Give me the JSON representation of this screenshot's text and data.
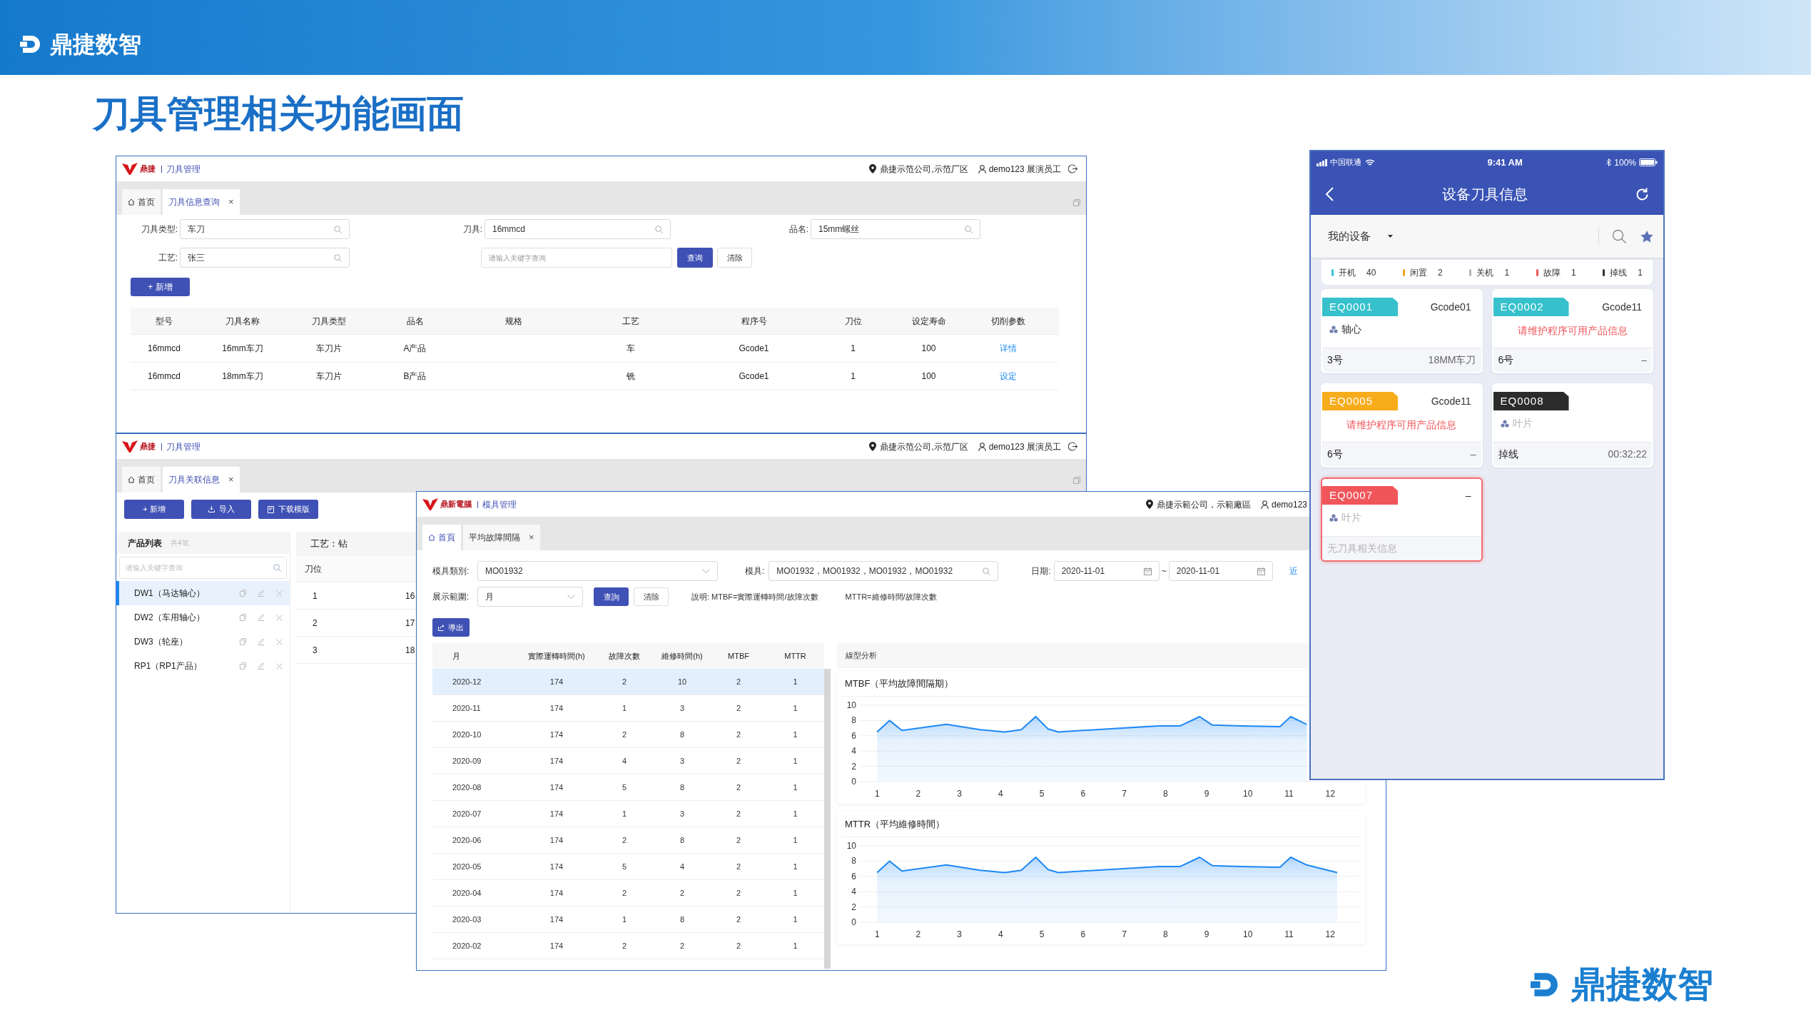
{
  "slide": {
    "brand": "鼎捷数智",
    "title": "刀具管理相关功能画面",
    "footer_brand": "鼎捷数智"
  },
  "tool_query_window": {
    "header": {
      "brand": "鼎捷",
      "module": "刀具管理",
      "location": "鼎捷示范公司,示范厂区",
      "user": "demo123 展演员工"
    },
    "tabs": [
      {
        "label": "首页",
        "selected": false
      },
      {
        "label": "刀具信息查询",
        "selected": true,
        "close": "×"
      }
    ],
    "filters": [
      {
        "label": "刀具类型:",
        "value": "车刀"
      },
      {
        "label": "刀具:",
        "value": "16mmcd"
      },
      {
        "label": "品名:",
        "value": "15mm螺丝"
      },
      {
        "label": "工艺:",
        "value": "张三"
      }
    ],
    "keyword": {
      "placeholder": "请输入关键字查询"
    },
    "query_button": "查询",
    "clear_button": "清除",
    "add_button": "+ 新增",
    "table": {
      "columns": [
        "型号",
        "刀具名称",
        "刀具类型",
        "品名",
        "规格",
        "工艺",
        "程序号",
        "刀位",
        "设定寿命",
        "切削参数"
      ],
      "rows": [
        {
          "cells": [
            "16mmcd",
            "16mm车刀",
            "车刀片",
            "A产品",
            "",
            "车",
            "Gcode1",
            "1",
            "100"
          ],
          "action": "详情"
        },
        {
          "cells": [
            "16mmcd",
            "18mm车刀",
            "车刀片",
            "B产品",
            "",
            "铣",
            "Gcode1",
            "1",
            "100"
          ],
          "action": "设定"
        }
      ]
    }
  },
  "association_window": {
    "header": {
      "brand": "鼎捷",
      "module": "刀具管理",
      "location": "鼎捷示范公司,示范厂区",
      "user": "demo123 展演员工"
    },
    "tabs": [
      {
        "label": "首页",
        "selected": false
      },
      {
        "label": "刀具关联信息",
        "selected": true,
        "close": "×"
      }
    ],
    "buttons": [
      {
        "kind": "add",
        "label": "+ 新增"
      },
      {
        "kind": "import",
        "label": "导入"
      },
      {
        "kind": "template",
        "label": "下载模版"
      }
    ],
    "product_list": {
      "title": "产品列表",
      "count": "共4笔",
      "search": {
        "placeholder": "请输入关键字查询"
      },
      "items": [
        {
          "label": "DW1（马达轴心）",
          "selected": true
        },
        {
          "label": "DW2（车用轴心）",
          "selected": false
        },
        {
          "label": "DW3（轮座）",
          "selected": false
        },
        {
          "label": "RP1（RP1产品）",
          "selected": false
        }
      ]
    },
    "process": {
      "title": "工艺：钻",
      "columns": [
        "刀位"
      ],
      "rows": [
        [
          "1",
          "16"
        ],
        [
          "2",
          "17"
        ],
        [
          "3",
          "18"
        ]
      ]
    }
  },
  "mold_window": {
    "header": {
      "brand": "鼎新電腦",
      "module": "模具管理",
      "location": "鼎捷示範公司，示範廠區",
      "user": "demo123"
    },
    "tabs": [
      {
        "label": "首頁",
        "selected": true
      },
      {
        "label": "平均故障間隔",
        "selected": false,
        "close": "×"
      }
    ],
    "category": {
      "label": "模具類別:",
      "value": "MO01932"
    },
    "mold": {
      "label": "模具:",
      "value": "MO01932，MO01932，MO01932，MO01932"
    },
    "date": {
      "label": "日期:",
      "from": "2020-11-01",
      "separator": "~",
      "to": "2020-11-01"
    },
    "recent_link": "近",
    "range": {
      "label": "展示範圍:",
      "value": "月"
    },
    "query_button": "查詢",
    "clear_button": "清除",
    "notes": [
      "說明: MTBF=實際運轉時間/故障次數",
      "MTTR=維修時間/故障次數"
    ],
    "export_button": "導出",
    "table": {
      "columns": [
        "月",
        "實際運轉時間(h)",
        "故障次數",
        "維修時間(h)",
        "MTBF",
        "MTTR"
      ],
      "rows": [
        {
          "cells": [
            "2020-12",
            "174",
            "2",
            "10",
            "2",
            "1"
          ],
          "selected": true
        },
        {
          "cells": [
            "2020-11",
            "174",
            "1",
            "3",
            "2",
            "1"
          ],
          "selected": false
        },
        {
          "cells": [
            "2020-10",
            "174",
            "2",
            "8",
            "2",
            "1"
          ],
          "selected": false
        },
        {
          "cells": [
            "2020-09",
            "174",
            "4",
            "3",
            "2",
            "1"
          ],
          "selected": false
        },
        {
          "cells": [
            "2020-08",
            "174",
            "5",
            "8",
            "2",
            "1"
          ],
          "selected": false
        },
        {
          "cells": [
            "2020-07",
            "174",
            "1",
            "3",
            "2",
            "1"
          ],
          "selected": false
        },
        {
          "cells": [
            "2020-06",
            "174",
            "2",
            "8",
            "2",
            "1"
          ],
          "selected": false
        },
        {
          "cells": [
            "2020-05",
            "174",
            "5",
            "4",
            "2",
            "1"
          ],
          "selected": false
        },
        {
          "cells": [
            "2020-04",
            "174",
            "2",
            "2",
            "2",
            "1"
          ],
          "selected": false
        },
        {
          "cells": [
            "2020-03",
            "174",
            "1",
            "8",
            "2",
            "1"
          ],
          "selected": false
        },
        {
          "cells": [
            "2020-02",
            "174",
            "2",
            "2",
            "2",
            "1"
          ],
          "selected": false
        }
      ]
    },
    "analysis": {
      "title": "線型分析",
      "charts": [
        {
          "chart_data": {
            "type": "area",
            "title": "MTBF（平均故障間隔期）",
            "x": [
              1.0,
              1.3,
              1.6,
              2.68,
              3.5,
              4.1,
              4.5,
              4.85,
              5.15,
              5.4,
              6.0,
              7.84,
              8.36,
              8.83,
              9.14,
              9.83,
              10.78,
              11.04,
              11.43
            ],
            "series": [
              {
                "color": "#1e88f5",
                "values": [
                  6.5,
                  8.0,
                  6.7,
                  7.5,
                  6.8,
                  6.5,
                  6.8,
                  8.5,
                  6.9,
                  6.5,
                  6.7,
                  7.3,
                  7.3,
                  8.5,
                  7.4,
                  7.3,
                  7.2,
                  8.5,
                  7.5
                ]
              }
            ],
            "xlim": [
              0.58,
              12.69
            ],
            "ylim": [
              0,
              10
            ],
            "xticks": [
              1,
              2,
              3,
              4,
              5,
              6,
              7,
              8,
              9,
              10,
              11,
              12
            ],
            "yticks": [
              0,
              2,
              4,
              6,
              8,
              10
            ],
            "grid": true
          }
        },
        {
          "chart_data": {
            "type": "area",
            "title": "MTTR（平均維修時間）",
            "x": [
              1.0,
              1.3,
              1.6,
              2.68,
              3.5,
              4.1,
              4.5,
              4.85,
              5.15,
              5.4,
              6.0,
              7.84,
              8.36,
              8.83,
              9.14,
              9.83,
              10.78,
              11.04,
              11.43,
              12.17
            ],
            "series": [
              {
                "color": "#1e88f5",
                "values": [
                  6.5,
                  8.0,
                  6.7,
                  7.5,
                  6.8,
                  6.5,
                  6.8,
                  8.5,
                  6.9,
                  6.5,
                  6.7,
                  7.3,
                  7.3,
                  8.5,
                  7.4,
                  7.3,
                  7.2,
                  8.5,
                  7.5,
                  6.5
                ]
              }
            ],
            "xlim": [
              0.58,
              12.69
            ],
            "ylim": [
              0,
              10
            ],
            "xticks": [
              1,
              2,
              3,
              4,
              5,
              6,
              7,
              8,
              9,
              10,
              11,
              12
            ],
            "yticks": [
              0,
              2,
              4,
              6,
              8,
              10
            ],
            "grid": true
          }
        }
      ]
    }
  },
  "mobile": {
    "status": {
      "carrier": "中国联通",
      "time": "9:41 AM",
      "battery": "100%"
    },
    "title": "设备刀具信息",
    "filter": "我的设备",
    "legend": [
      {
        "label": "开机",
        "count": "40",
        "color": "#3cc3d6"
      },
      {
        "label": "闲置",
        "count": "2",
        "color": "#f5a623"
      },
      {
        "label": "关机",
        "count": "1",
        "color": "#b5b5b5"
      },
      {
        "label": "故障",
        "count": "1",
        "color": "#f0555a"
      },
      {
        "label": "掉线",
        "count": "1",
        "color": "#333333"
      }
    ],
    "cards": [
      {
        "code": "EQ0001",
        "color": "#36c1cc",
        "program": "Gcode01",
        "line": {
          "kind": "part",
          "text": "轴心",
          "muted": false
        },
        "footer": {
          "kind": "values",
          "left": "3号",
          "right": "18MM车刀"
        },
        "alert": false
      },
      {
        "code": "EQ0002",
        "color": "#36c1cc",
        "program": "Gcode11",
        "line": {
          "kind": "warning",
          "text": "请维护程序可用产品信息"
        },
        "footer": {
          "kind": "values",
          "left": "6号",
          "right": "–"
        },
        "alert": false
      },
      {
        "code": "EQ0005",
        "color": "#f7ac1b",
        "program": "Gcode11",
        "line": {
          "kind": "warning",
          "text": "请维护程序可用产品信息"
        },
        "footer": {
          "kind": "values",
          "left": "6号",
          "right": "–"
        },
        "alert": false
      },
      {
        "code": "EQ0008",
        "color": "#2b2b2b",
        "line": {
          "kind": "part",
          "text": "叶片",
          "muted": true
        },
        "footer": {
          "kind": "values",
          "left": "掉线",
          "right": "00:32:22"
        },
        "alert": false
      },
      {
        "code": "EQ0007",
        "color": "#f0555a",
        "program": "–",
        "line": {
          "kind": "part",
          "text": "叶片",
          "muted": true
        },
        "footer": {
          "kind": "note",
          "text": "无刀具相关信息"
        },
        "alert": true
      }
    ]
  }
}
